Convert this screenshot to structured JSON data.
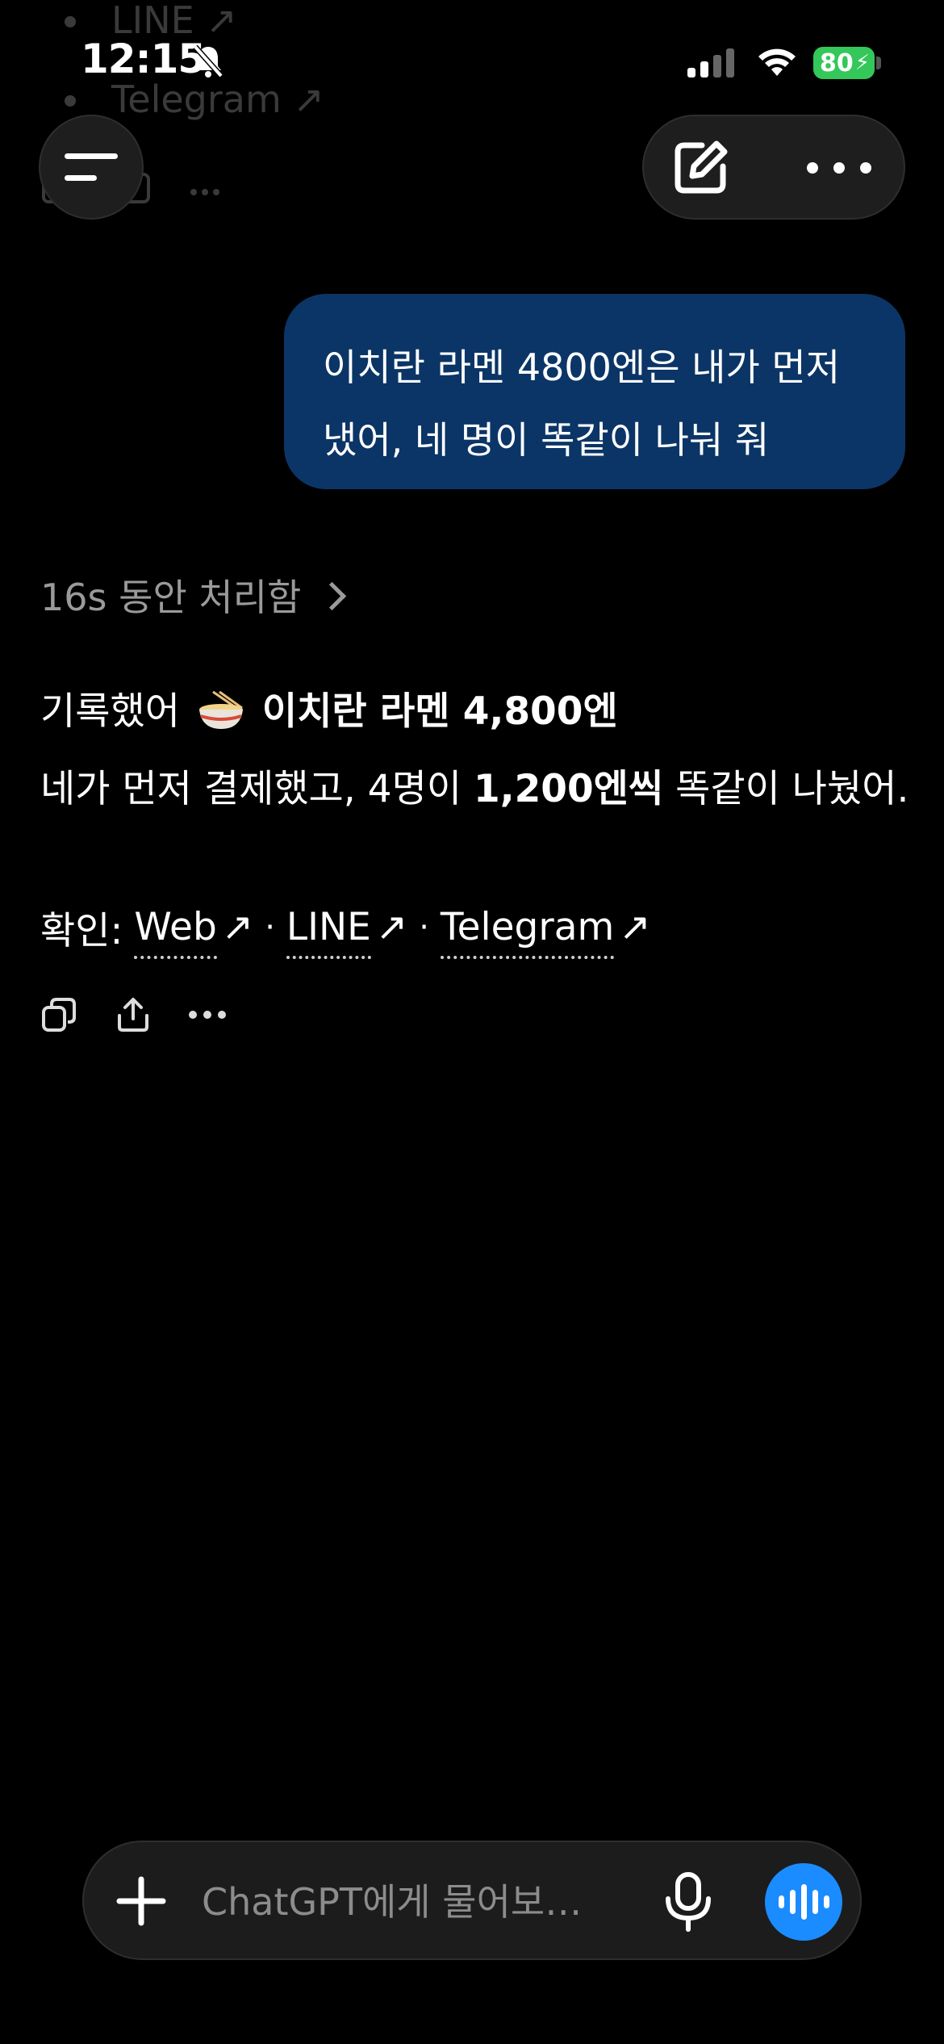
{
  "status_bar": {
    "time": "12:15",
    "battery": "80"
  },
  "background_scroll": {
    "items": [
      "LINE",
      "Telegram"
    ]
  },
  "user_message": {
    "line1": "이치란 라멘 4800엔은 내가 먼저",
    "line2": "냈어, 네 명이 똑같이 나눠 줘"
  },
  "thinking": {
    "label": "16s 동안 처리함"
  },
  "assistant": {
    "line1_prefix": "기록했어",
    "line1_bold": "이치란 라멘 4,800엔",
    "line2_prefix": "네가 먼저 결제했고, 4명이",
    "line2_bold": "1,200엔씩",
    "line2_suffix": "똑같이 나눴어.",
    "confirm_label": "확인:",
    "links": [
      "Web",
      "LINE",
      "Telegram"
    ],
    "separator": "·"
  },
  "composer": {
    "placeholder": "ChatGPT에게 물어보…"
  },
  "colors": {
    "user_bubble": "#0b3566",
    "voice_button": "#1a8cff",
    "battery": "#34c759"
  }
}
